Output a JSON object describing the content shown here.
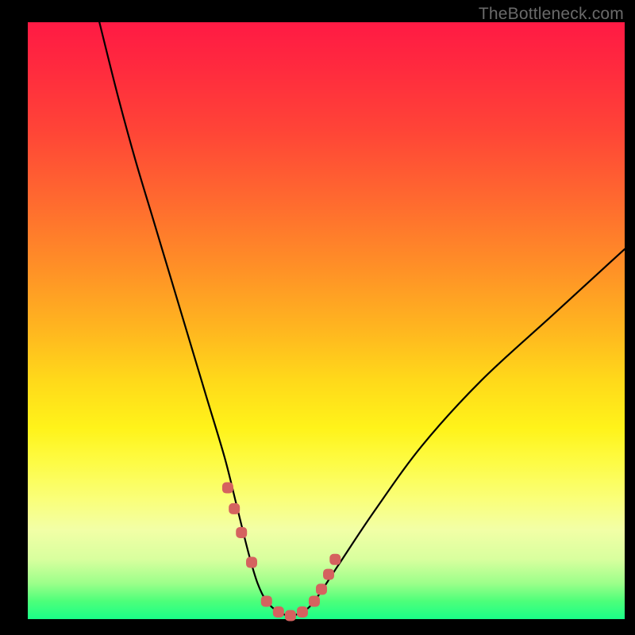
{
  "watermark": "TheBottleneck.com",
  "chart_data": {
    "type": "line",
    "title": "",
    "xlabel": "",
    "ylabel": "",
    "xlim": [
      0,
      100
    ],
    "ylim": [
      0,
      100
    ],
    "grid": false,
    "series": [
      {
        "name": "curve",
        "color": "#000000",
        "x": [
          12,
          15,
          18,
          21,
          24,
          27,
          30,
          33,
          35,
          37,
          38.5,
          40,
          42,
          44,
          46,
          48,
          52,
          58,
          66,
          76,
          88,
          100
        ],
        "values": [
          100,
          88,
          77,
          67,
          57,
          47,
          37,
          27,
          19,
          11,
          6,
          3,
          1.2,
          0.6,
          1.2,
          3,
          9,
          18,
          29,
          40,
          51,
          62
        ]
      },
      {
        "name": "highlight-markers",
        "color": "#d5625f",
        "x": [
          33.5,
          34.6,
          35.8,
          37.5,
          40.0,
          42.0,
          44.0,
          46.0,
          48.0,
          49.2,
          50.4,
          51.5
        ],
        "values": [
          22,
          18.5,
          14.5,
          9.5,
          3.0,
          1.2,
          0.6,
          1.2,
          3.0,
          5.0,
          7.5,
          10.0
        ]
      }
    ],
    "annotations": []
  }
}
